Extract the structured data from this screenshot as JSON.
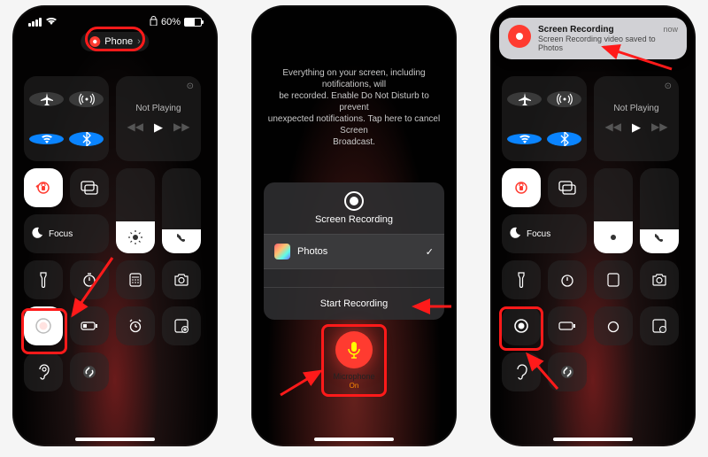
{
  "status": {
    "battery_pct": "60%",
    "lock_icon": "lock"
  },
  "pill": {
    "label": "Phone",
    "chevron": "›"
  },
  "media": {
    "label": "Not Playing"
  },
  "focus": {
    "label": "Focus"
  },
  "screen2": {
    "warning_l1": "Everything on your screen, including notifications, will",
    "warning_l2": "be recorded. Enable Do Not Disturb to prevent",
    "warning_l3": "unexpected notifications. Tap here to cancel Screen",
    "warning_l4": "Broadcast.",
    "popup_title": "Screen Recording",
    "option_label": "Photos",
    "start_label": "Start Recording",
    "mic_label": "Microphone",
    "mic_state": "On"
  },
  "screen3": {
    "banner_title": "Screen Recording",
    "banner_sub": "Screen Recording video saved to Photos",
    "banner_time": "now"
  }
}
